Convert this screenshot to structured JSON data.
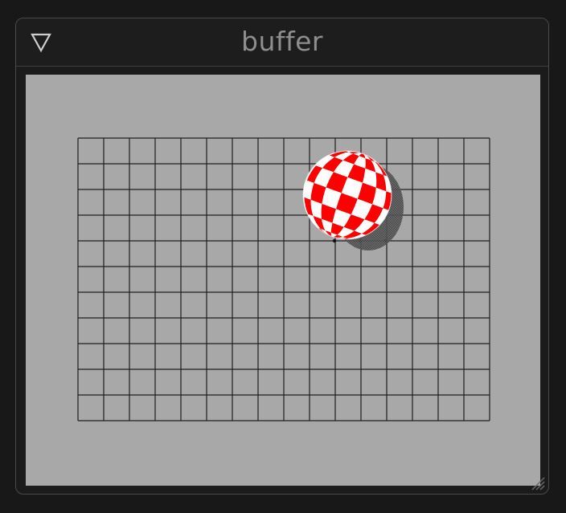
{
  "window": {
    "title": "buffer"
  },
  "icons": {
    "collapse": "triangle-down-outline-icon",
    "resize": "resize-grip-icon"
  },
  "scene": {
    "background_color": "#a8a8a8",
    "grid_line_color": "#1e1e1e",
    "ball_colors": [
      "#ff0000",
      "#ffffff"
    ],
    "shadow_color": "#444444"
  }
}
